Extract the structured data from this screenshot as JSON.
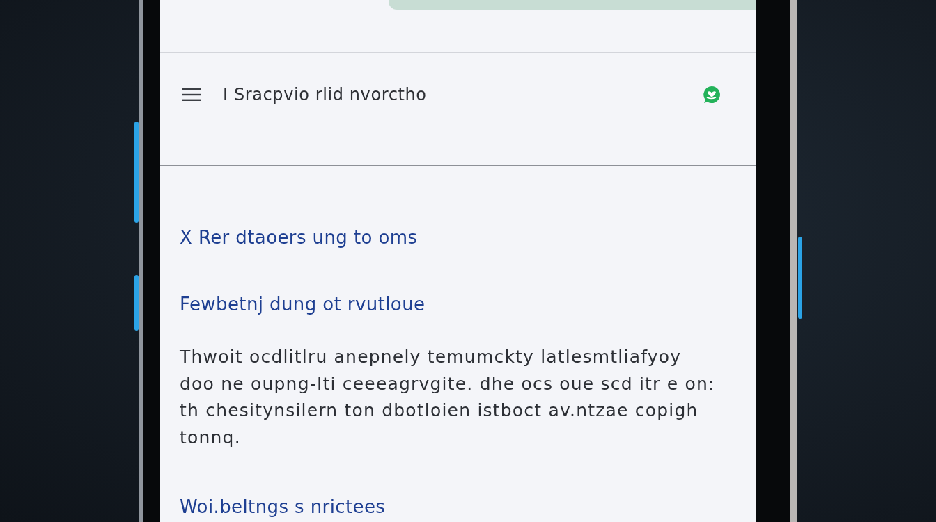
{
  "app_bar": {
    "title": "I Sracpvio rlid nvorctho"
  },
  "content": [
    {
      "kind": "heading",
      "text": "X Rer dtaoers ung to oms"
    },
    {
      "kind": "heading",
      "text": "Fewbetnj dung ot rvutloue"
    },
    {
      "kind": "paragraph",
      "text": "Thwoit ocdlitlru anepnely temumckty latlesmtliafyoy\ndoo ne oupng-Iti ceeeagrvgite. dhe ocs oue scd itr e on:\nth chesitynsilern ton dbotloien istboct av.ntzae copigh\ntonnq."
    },
    {
      "kind": "heading",
      "text": "Woi.beltngs s nrictees"
    }
  ]
}
